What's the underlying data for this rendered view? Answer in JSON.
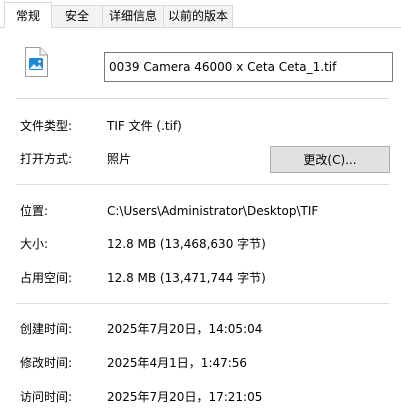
{
  "tabs": [
    {
      "label": "常规",
      "active": true
    },
    {
      "label": "安全",
      "active": false
    },
    {
      "label": "详细信息",
      "active": false
    },
    {
      "label": "以前的版本",
      "active": false
    }
  ],
  "file": {
    "name": "0039 Camera 46000 x Ceta Ceta_1.tif",
    "icon": "image-file-icon"
  },
  "type_row": {
    "label": "文件类型:",
    "value": "TIF 文件 (.tif)"
  },
  "opens_with": {
    "label": "打开方式:",
    "value": "照片",
    "button": "更改(C)..."
  },
  "location": {
    "label": "位置:",
    "value": "C:\\Users\\Administrator\\Desktop\\TIF"
  },
  "size": {
    "label": "大小:",
    "value": "12.8 MB (13,468,630 字节)"
  },
  "size_on_disk": {
    "label": "占用空间:",
    "value": "12.8 MB (13,471,744 字节)"
  },
  "created": {
    "label": "创建时间:",
    "value": "2025年7月20日，14:05:04"
  },
  "modified": {
    "label": "修改时间:",
    "value": "2025年4月1日，1:47:56"
  },
  "accessed": {
    "label": "访问时间:",
    "value": "2025年7月20日，17:21:05"
  },
  "colors": {
    "accent": "#0078d4",
    "icon_blue": "#1e88d8",
    "separator": "#dcdcdc"
  }
}
